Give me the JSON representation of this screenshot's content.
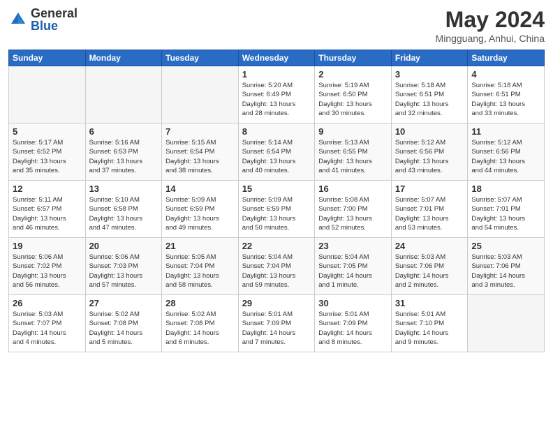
{
  "header": {
    "logo_general": "General",
    "logo_blue": "Blue",
    "month_title": "May 2024",
    "location": "Mingguang, Anhui, China"
  },
  "weekdays": [
    "Sunday",
    "Monday",
    "Tuesday",
    "Wednesday",
    "Thursday",
    "Friday",
    "Saturday"
  ],
  "weeks": [
    [
      {
        "day": "",
        "info": ""
      },
      {
        "day": "",
        "info": ""
      },
      {
        "day": "",
        "info": ""
      },
      {
        "day": "1",
        "info": "Sunrise: 5:20 AM\nSunset: 6:49 PM\nDaylight: 13 hours\nand 28 minutes."
      },
      {
        "day": "2",
        "info": "Sunrise: 5:19 AM\nSunset: 6:50 PM\nDaylight: 13 hours\nand 30 minutes."
      },
      {
        "day": "3",
        "info": "Sunrise: 5:18 AM\nSunset: 6:51 PM\nDaylight: 13 hours\nand 32 minutes."
      },
      {
        "day": "4",
        "info": "Sunrise: 5:18 AM\nSunset: 6:51 PM\nDaylight: 13 hours\nand 33 minutes."
      }
    ],
    [
      {
        "day": "5",
        "info": "Sunrise: 5:17 AM\nSunset: 6:52 PM\nDaylight: 13 hours\nand 35 minutes."
      },
      {
        "day": "6",
        "info": "Sunrise: 5:16 AM\nSunset: 6:53 PM\nDaylight: 13 hours\nand 37 minutes."
      },
      {
        "day": "7",
        "info": "Sunrise: 5:15 AM\nSunset: 6:54 PM\nDaylight: 13 hours\nand 38 minutes."
      },
      {
        "day": "8",
        "info": "Sunrise: 5:14 AM\nSunset: 6:54 PM\nDaylight: 13 hours\nand 40 minutes."
      },
      {
        "day": "9",
        "info": "Sunrise: 5:13 AM\nSunset: 6:55 PM\nDaylight: 13 hours\nand 41 minutes."
      },
      {
        "day": "10",
        "info": "Sunrise: 5:12 AM\nSunset: 6:56 PM\nDaylight: 13 hours\nand 43 minutes."
      },
      {
        "day": "11",
        "info": "Sunrise: 5:12 AM\nSunset: 6:56 PM\nDaylight: 13 hours\nand 44 minutes."
      }
    ],
    [
      {
        "day": "12",
        "info": "Sunrise: 5:11 AM\nSunset: 6:57 PM\nDaylight: 13 hours\nand 46 minutes."
      },
      {
        "day": "13",
        "info": "Sunrise: 5:10 AM\nSunset: 6:58 PM\nDaylight: 13 hours\nand 47 minutes."
      },
      {
        "day": "14",
        "info": "Sunrise: 5:09 AM\nSunset: 6:59 PM\nDaylight: 13 hours\nand 49 minutes."
      },
      {
        "day": "15",
        "info": "Sunrise: 5:09 AM\nSunset: 6:59 PM\nDaylight: 13 hours\nand 50 minutes."
      },
      {
        "day": "16",
        "info": "Sunrise: 5:08 AM\nSunset: 7:00 PM\nDaylight: 13 hours\nand 52 minutes."
      },
      {
        "day": "17",
        "info": "Sunrise: 5:07 AM\nSunset: 7:01 PM\nDaylight: 13 hours\nand 53 minutes."
      },
      {
        "day": "18",
        "info": "Sunrise: 5:07 AM\nSunset: 7:01 PM\nDaylight: 13 hours\nand 54 minutes."
      }
    ],
    [
      {
        "day": "19",
        "info": "Sunrise: 5:06 AM\nSunset: 7:02 PM\nDaylight: 13 hours\nand 56 minutes."
      },
      {
        "day": "20",
        "info": "Sunrise: 5:06 AM\nSunset: 7:03 PM\nDaylight: 13 hours\nand 57 minutes."
      },
      {
        "day": "21",
        "info": "Sunrise: 5:05 AM\nSunset: 7:04 PM\nDaylight: 13 hours\nand 58 minutes."
      },
      {
        "day": "22",
        "info": "Sunrise: 5:04 AM\nSunset: 7:04 PM\nDaylight: 13 hours\nand 59 minutes."
      },
      {
        "day": "23",
        "info": "Sunrise: 5:04 AM\nSunset: 7:05 PM\nDaylight: 14 hours\nand 1 minute."
      },
      {
        "day": "24",
        "info": "Sunrise: 5:03 AM\nSunset: 7:06 PM\nDaylight: 14 hours\nand 2 minutes."
      },
      {
        "day": "25",
        "info": "Sunrise: 5:03 AM\nSunset: 7:06 PM\nDaylight: 14 hours\nand 3 minutes."
      }
    ],
    [
      {
        "day": "26",
        "info": "Sunrise: 5:03 AM\nSunset: 7:07 PM\nDaylight: 14 hours\nand 4 minutes."
      },
      {
        "day": "27",
        "info": "Sunrise: 5:02 AM\nSunset: 7:08 PM\nDaylight: 14 hours\nand 5 minutes."
      },
      {
        "day": "28",
        "info": "Sunrise: 5:02 AM\nSunset: 7:08 PM\nDaylight: 14 hours\nand 6 minutes."
      },
      {
        "day": "29",
        "info": "Sunrise: 5:01 AM\nSunset: 7:09 PM\nDaylight: 14 hours\nand 7 minutes."
      },
      {
        "day": "30",
        "info": "Sunrise: 5:01 AM\nSunset: 7:09 PM\nDaylight: 14 hours\nand 8 minutes."
      },
      {
        "day": "31",
        "info": "Sunrise: 5:01 AM\nSunset: 7:10 PM\nDaylight: 14 hours\nand 9 minutes."
      },
      {
        "day": "",
        "info": ""
      }
    ]
  ]
}
